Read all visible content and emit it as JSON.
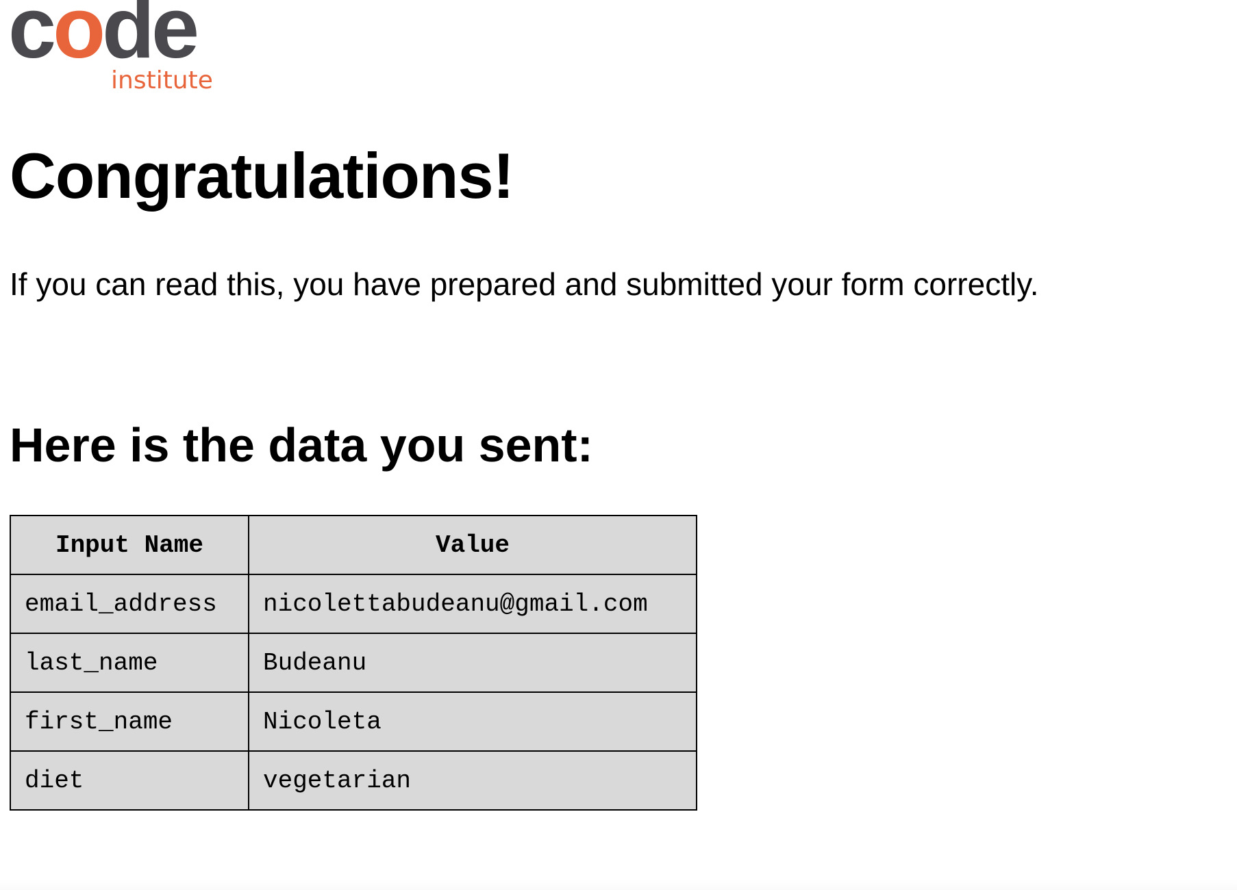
{
  "logo": {
    "word_before": "c",
    "word_accent": "o",
    "word_after": "de",
    "subtext": "institute",
    "colors": {
      "dark": "#4a4a4e",
      "accent": "#e8643a"
    }
  },
  "heading": "Congratulations!",
  "intro": "If you can read this, you have prepared and submitted your form correctly.",
  "subheading": "Here is the data you sent:",
  "table": {
    "headers": [
      "Input Name",
      "Value"
    ],
    "rows": [
      [
        "email_address",
        "nicolettabudeanu@gmail.com"
      ],
      [
        "last_name",
        "Budeanu"
      ],
      [
        "first_name",
        "Nicoleta"
      ],
      [
        "diet",
        "vegetarian"
      ]
    ]
  }
}
